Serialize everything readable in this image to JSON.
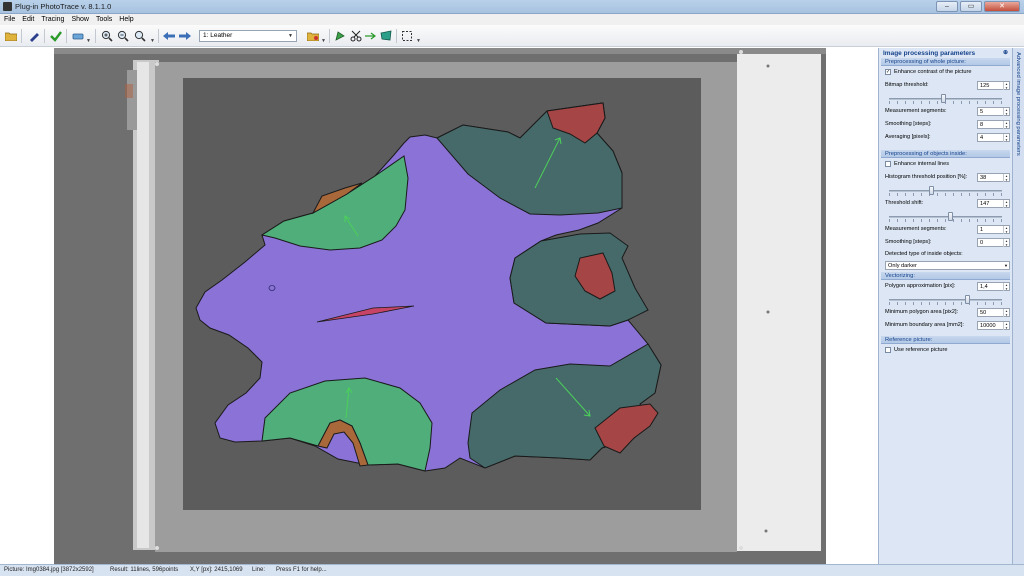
{
  "window": {
    "title": "Plug-in PhotoTrace v. 8.1.1.0",
    "buttons": [
      "–",
      "▭",
      "✕"
    ]
  },
  "menu": [
    "File",
    "Edit",
    "Tracing",
    "Show",
    "Tools",
    "Help"
  ],
  "toolbar": {
    "layer_combo": "1: Leather"
  },
  "panel": {
    "title": "Image processing parameters",
    "side_tab": "Advanced image processing parameters",
    "sections": {
      "whole": "Preprocessing of whole picture:",
      "inside": "Preprocessing of objects inside:",
      "vector": "Vectorizing:",
      "reference": "Reference picture:"
    },
    "enhance_contrast": {
      "label": "Enhance contrast of the picture",
      "checked": true
    },
    "bitmap_threshold": {
      "label": "Bitmap threshold:",
      "value": "125",
      "slider": 0.49
    },
    "measurement_segments": {
      "label": "Measurement segments:",
      "value": "5"
    },
    "smoothing_steps": {
      "label": "Smoothing [steps]:",
      "value": "8"
    },
    "averaging_pixels": {
      "label": "Averaging [pixels]:",
      "value": "4"
    },
    "enhance_internal": {
      "label": "Enhance internal lines",
      "checked": false
    },
    "histogram_threshold": {
      "label": "Histogram threshold position [%]:",
      "value": "38",
      "slider": 0.38
    },
    "threshold_shift": {
      "label": "Threshold shift:",
      "value": "147",
      "slider": 0.55
    },
    "inside_segments": {
      "label": "Measurement segments:",
      "value": "1"
    },
    "inside_smoothing": {
      "label": "Smoothing [steps]:",
      "value": "0"
    },
    "detected_type": {
      "label": "Detected type of inside objects:",
      "value": "Only darker"
    },
    "polygon_approx": {
      "label": "Polygon approximation [pix]:",
      "value": "1,4",
      "slider": 0.7
    },
    "min_polygon_area": {
      "label": "Minimum polygon area [pix2]:",
      "value": "50"
    },
    "min_boundary_area": {
      "label": "Minimum boundary area [mm2]:",
      "value": "10000"
    },
    "use_reference": {
      "label": "Use reference picture",
      "checked": false
    }
  },
  "status": {
    "picture": "Picture: Img0384.jpg [3872x2592]",
    "result": "Result: 11lines, 596points",
    "xy": "X,Y [px]: 2415,1069",
    "line": "Line:",
    "help": "Press F1 for help..."
  },
  "colors": {
    "leather": "#8a72d6",
    "green": "#4fae7a",
    "teal": "#466a6a",
    "red": "#a54545",
    "brown": "#a8683a",
    "cut": "#c84466",
    "arrow": "#4cd05a"
  }
}
